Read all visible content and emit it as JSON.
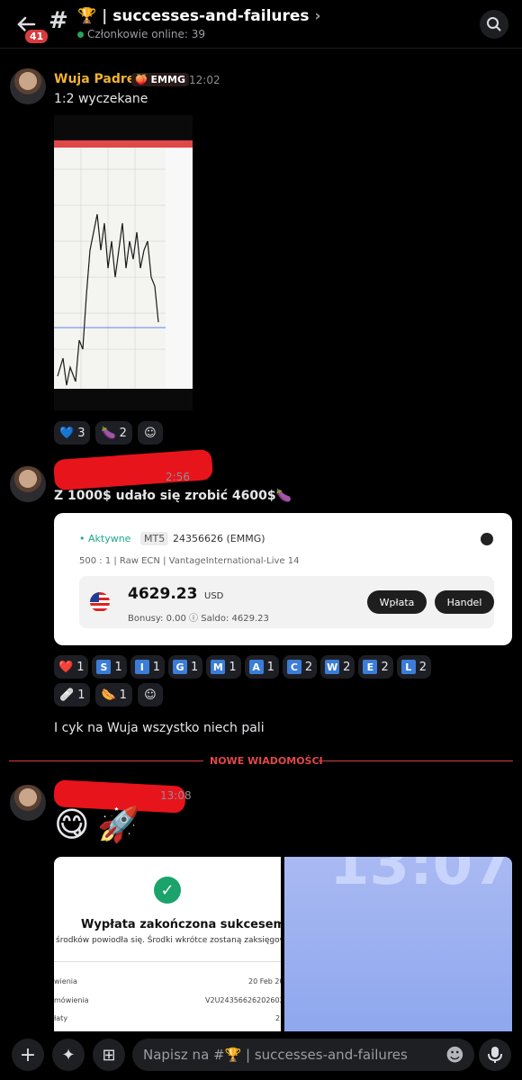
{
  "header": {
    "unread_count": "41",
    "hash": "#",
    "channel_emoji": "🏆",
    "channel_name": "successes-and-failures",
    "online_text": "Członkowie online: 39"
  },
  "messages": [
    {
      "username": "Wuja Padre",
      "role_emoji": "🍑",
      "role": "EMMG",
      "time": "12:02",
      "text": "1:2 wyczekane",
      "reactions": [
        {
          "emoji": "💙",
          "count": "3"
        },
        {
          "emoji": "🍆",
          "count": "2"
        }
      ]
    },
    {
      "time_suffix": "2:56",
      "text": "Z 1000$ udało się zrobić 4600$🍆",
      "card": {
        "status": "• Aktywne",
        "platform": "MT5",
        "account": "24356626 (EMMG)",
        "info": "500 : 1   |   Raw ECN   |   VantageInternational-Live 14",
        "amount": "4629.23",
        "currency": "USD",
        "bonus": "Bonusy: 0.00 ⓘ     Saldo:  4629.23",
        "btn_withdraw": "Wpłata",
        "btn_trade": "Handel"
      },
      "reactions_row1": [
        {
          "emoji": "❤️",
          "count": "1"
        },
        {
          "letter": "S",
          "count": "1"
        },
        {
          "letter": "I",
          "count": "1"
        },
        {
          "letter": "G",
          "count": "1"
        },
        {
          "letter": "M",
          "count": "1"
        },
        {
          "letter": "A",
          "count": "1"
        },
        {
          "letter": "C",
          "count": "2"
        },
        {
          "letter": "W",
          "count": "2"
        },
        {
          "letter": "E",
          "count": "2"
        },
        {
          "letter": "L",
          "count": "2"
        }
      ],
      "reactions_row2": [
        {
          "emoji": "🩹",
          "count": "1"
        },
        {
          "emoji": "🌭",
          "count": "1"
        }
      ],
      "followup": "I cyk na Wuja wszystko niech pali"
    },
    {
      "time_suffix": "13:08",
      "emojis": [
        "😋",
        "🚀"
      ],
      "success_title": "Wypłata zakończona sukcesem",
      "success_sub": "środków powiodła się. Środki wkrótce zostaną zaksięgowane",
      "rows": [
        {
          "label": "wienia",
          "value": "20 Feb 20"
        },
        {
          "label": "mówienia",
          "value": "V2U243566262026022"
        },
        {
          "label": "łaty",
          "value": "2"
        }
      ],
      "clock": "13:07"
    }
  ],
  "divider": "NOWE WIADOMOŚCI",
  "composer": {
    "placeholder": "Napisz na #🏆 | successes-and-failures"
  },
  "colors": {
    "accent_red": "#d83c3e",
    "username_gold": "#f0b232",
    "online_green": "#23a55a"
  }
}
